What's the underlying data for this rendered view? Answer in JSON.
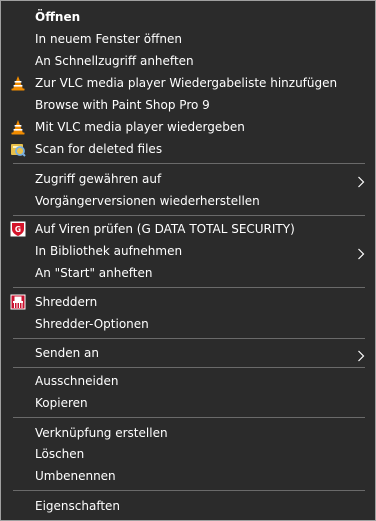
{
  "menu": {
    "items": [
      {
        "label": "Öffnen"
      },
      {
        "label": "In neuem Fenster öffnen"
      },
      {
        "label": "An Schnellzugriff anheften"
      },
      {
        "label": "Zur VLC media player Wiedergabeliste hinzufügen",
        "icon": "vlc-cone-icon"
      },
      {
        "label": "Browse with Paint Shop Pro 9"
      },
      {
        "label": "Mit VLC media player wiedergeben",
        "icon": "vlc-cone-icon"
      },
      {
        "label": "Scan for deleted files",
        "icon": "recovery-scan-icon"
      },
      {
        "label": "Zugriff gewähren auf",
        "submenu": true
      },
      {
        "label": "Vorgängerversionen wiederherstellen"
      },
      {
        "label": "Auf Viren prüfen (G DATA TOTAL SECURITY)",
        "icon": "gdata-shield-icon"
      },
      {
        "label": "In Bibliothek aufnehmen",
        "submenu": true
      },
      {
        "label": "An \"Start\" anheften"
      },
      {
        "label": "Shreddern",
        "icon": "shredder-icon"
      },
      {
        "label": "Shredder-Optionen"
      },
      {
        "label": "Senden an",
        "submenu": true
      },
      {
        "label": "Ausschneiden"
      },
      {
        "label": "Kopieren"
      },
      {
        "label": "Verknüpfung erstellen"
      },
      {
        "label": "Löschen"
      },
      {
        "label": "Umbenennen"
      },
      {
        "label": "Eigenschaften"
      }
    ]
  },
  "colors": {
    "background": "#2b2b2b",
    "text": "#ffffff",
    "separator": "#6a6a6a",
    "border": "#a0a0a0",
    "vlc_orange": "#f28c00",
    "gdata_red": "#d4142a"
  }
}
